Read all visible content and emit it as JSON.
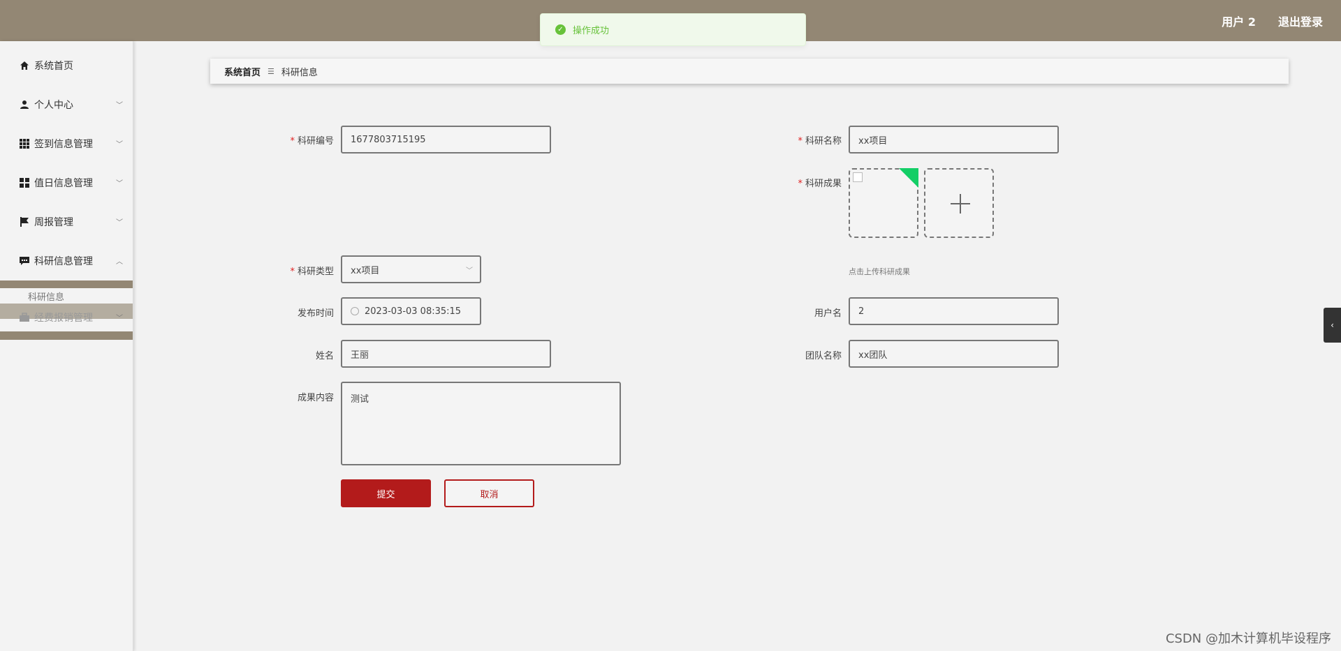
{
  "header": {
    "user": "用户 2",
    "logout": "退出登录"
  },
  "toast": {
    "message": "操作成功"
  },
  "sidebar": {
    "items": [
      {
        "label": "系统首页",
        "icon": "home-icon"
      },
      {
        "label": "个人中心",
        "icon": "user-icon"
      },
      {
        "label": "签到信息管理",
        "icon": "grid-icon"
      },
      {
        "label": "值日信息管理",
        "icon": "apps-icon"
      },
      {
        "label": "周报管理",
        "icon": "flag-icon"
      },
      {
        "label": "科研信息管理",
        "icon": "message-icon"
      }
    ],
    "sub_item": "科研信息",
    "next_item": {
      "label": "经费报销管理",
      "icon": "briefcase-icon"
    }
  },
  "breadcrumb": {
    "home": "系统首页",
    "current": "科研信息"
  },
  "form": {
    "research_no": {
      "label": "科研编号",
      "value": "1677803715195"
    },
    "research_name": {
      "label": "科研名称",
      "value": "xx项目"
    },
    "research_result": {
      "label": "科研成果",
      "hint": "点击上传科研成果"
    },
    "research_type": {
      "label": "科研类型",
      "value": "xx项目"
    },
    "publish_time": {
      "label": "发布时间",
      "value": "2023-03-03 08:35:15"
    },
    "username": {
      "label": "用户名",
      "value": "2"
    },
    "name": {
      "label": "姓名",
      "value": "王丽"
    },
    "team_name": {
      "label": "团队名称",
      "value": "xx团队"
    },
    "content": {
      "label": "成果内容",
      "value": "测试"
    },
    "submit": "提交",
    "cancel": "取消"
  },
  "watermark": "CSDN @加木计算机毕设程序"
}
